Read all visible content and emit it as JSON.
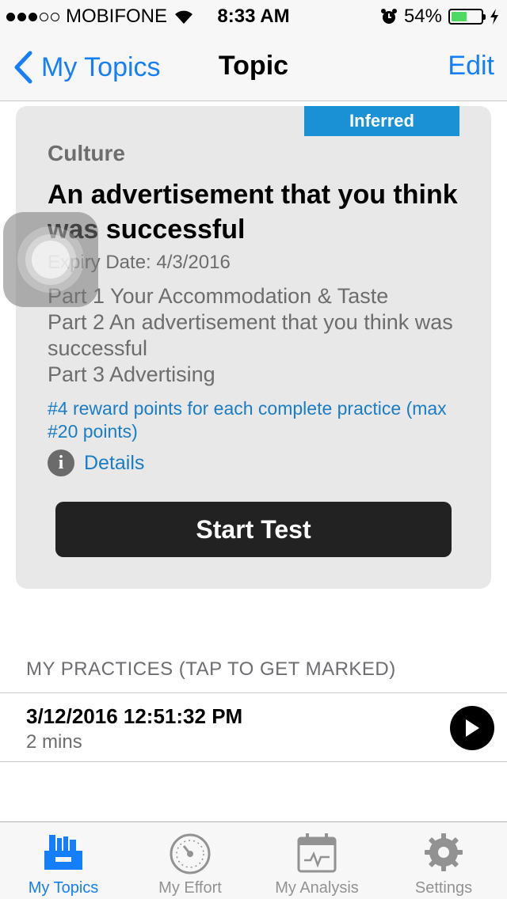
{
  "status_bar": {
    "carrier": "MOBIFONE",
    "time": "8:33 AM",
    "battery": "54%",
    "battery_level": 0.54
  },
  "nav": {
    "back_label": "My Topics",
    "title": "Topic",
    "edit_label": "Edit"
  },
  "card": {
    "badge": "Inferred",
    "category": "Culture",
    "title": "An advertisement that you think was successful",
    "expiry": "Expiry Date: 4/3/2016",
    "parts": [
      "Part 1 Your Accommodation & Taste",
      "Part 2 An advertisement that you think was successful",
      "Part 3 Advertising"
    ],
    "reward": "#4 reward points for each complete practice (max #20 points)",
    "details_label": "Details",
    "start_button": "Start Test"
  },
  "practices": {
    "header": "MY PRACTICES (TAP TO GET MARKED)",
    "items": [
      {
        "date": "3/12/2016 12:51:32 PM",
        "duration": "2 mins"
      }
    ]
  },
  "tabs": [
    {
      "label": "My Topics",
      "icon": "topics-icon",
      "active": true
    },
    {
      "label": "My Effort",
      "icon": "gauge-icon",
      "active": false
    },
    {
      "label": "My Analysis",
      "icon": "calendar-chart-icon",
      "active": false
    },
    {
      "label": "Settings",
      "icon": "gear-icon",
      "active": false
    }
  ],
  "colors": {
    "accent": "#157efb",
    "badge": "#1a91d5",
    "link": "#1a7cc4",
    "battery": "#4cd964"
  }
}
